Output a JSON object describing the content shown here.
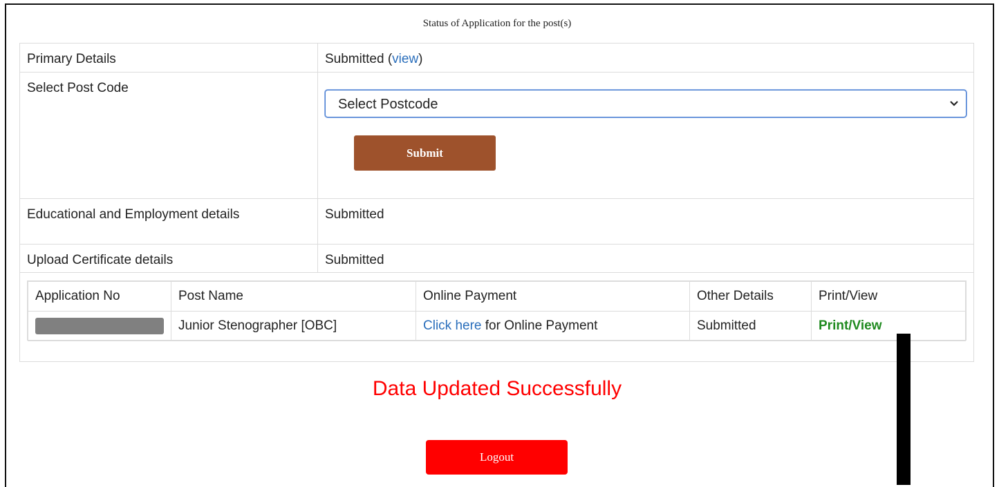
{
  "page": {
    "caption": "Status of Application for the post(s)",
    "status_message": "Data Updated Successfully",
    "logout_label": "Logout"
  },
  "status_rows": {
    "primary": {
      "label": "Primary Details",
      "value": "Submitted",
      "paren_open": "(",
      "link": "view",
      "paren_close": ")"
    },
    "postcode": {
      "label": "Select Post Code",
      "selected": "Select Postcode",
      "submit_label": "Submit"
    },
    "education": {
      "label": "Educational and Employment details",
      "value": "Submitted"
    },
    "certificate": {
      "label": "Upload Certificate details",
      "value": "Submitted"
    }
  },
  "applications": {
    "headers": [
      "Application No",
      "Post Name",
      "Online Payment",
      "Other Details",
      "Print/View"
    ],
    "rows": [
      {
        "application_no": "",
        "post_name": "Junior Stenographer [OBC]",
        "payment_link": "Click here",
        "payment_text": " for Online Payment",
        "other_details": "Submitted",
        "print_view": "Print/View"
      }
    ]
  },
  "colors": {
    "submit_button": "#9e522c",
    "logout_button": "#ff0000",
    "status_message": "#ff0000",
    "link": "#2a6ebb",
    "print_view": "#1f8a1f"
  },
  "icons": {
    "select_arrow": "chevron-down-icon"
  }
}
